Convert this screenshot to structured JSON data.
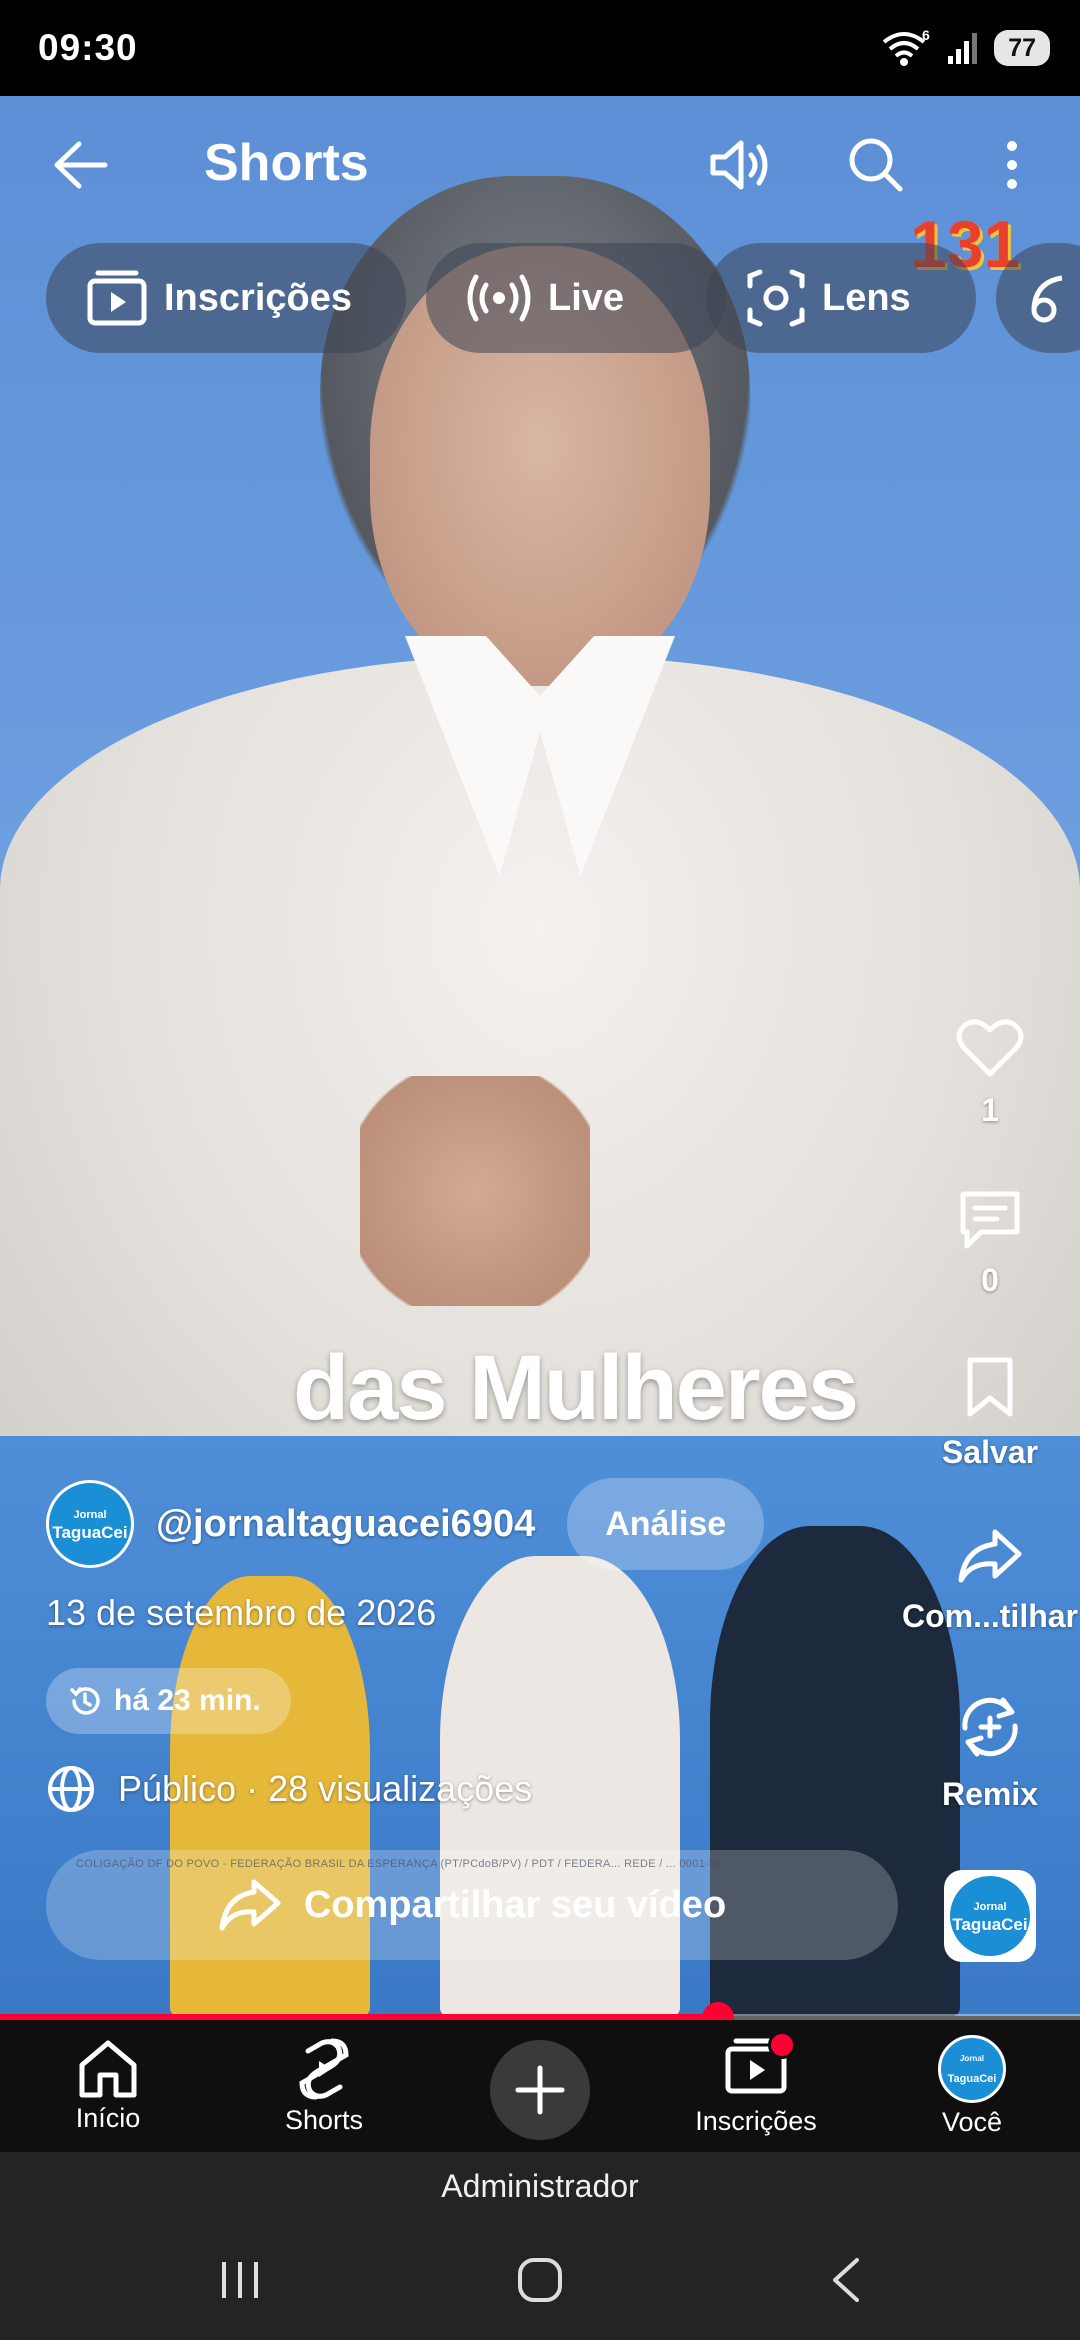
{
  "status_bar": {
    "time": "09:30",
    "wifi_label": "6",
    "battery": "77"
  },
  "header": {
    "title": "Shorts",
    "icons": [
      "back-arrow-icon",
      "volume-icon",
      "search-icon",
      "more-vertical-icon"
    ]
  },
  "chips": [
    {
      "label": "Inscrições",
      "icon": "subscriptions-icon"
    },
    {
      "label": "Live",
      "icon": "live-icon"
    },
    {
      "label": "Lens",
      "icon": "lens-icon"
    }
  ],
  "video": {
    "overlay_caption": "das Mulheres",
    "badge": "131",
    "disclaimer": "COLIGAÇÃO DF DO POVO - FEDERAÇÃO BRASIL DA ESPERANÇA (PT/PCdoB/PV) / PDT / FEDERA... REDE / ... 0001-59"
  },
  "actions": {
    "like_count": "1",
    "comment_count": "0",
    "save_label": "Salvar",
    "share_label": "Com...tilhar",
    "remix_label": "Remix"
  },
  "channel": {
    "avatar_top": "Jornal",
    "avatar_bottom": "TaguaCei",
    "handle": "@jornaltaguacei6904",
    "analise_label": "Análise"
  },
  "meta": {
    "date": "13 de setembro de 2026",
    "time_ago": "há 23 min.",
    "privacy_views": "Público · 28 visualizações"
  },
  "share_video_label": "Compartilhar seu vídeo",
  "progress": 0.665,
  "bottom_nav": {
    "home": "Início",
    "shorts": "Shorts",
    "subscriptions": "Inscrições",
    "you": "Você"
  },
  "admin_label": "Administrador",
  "colors": {
    "accent": "#ff0033",
    "nav_bg": "#0f0f0f"
  }
}
